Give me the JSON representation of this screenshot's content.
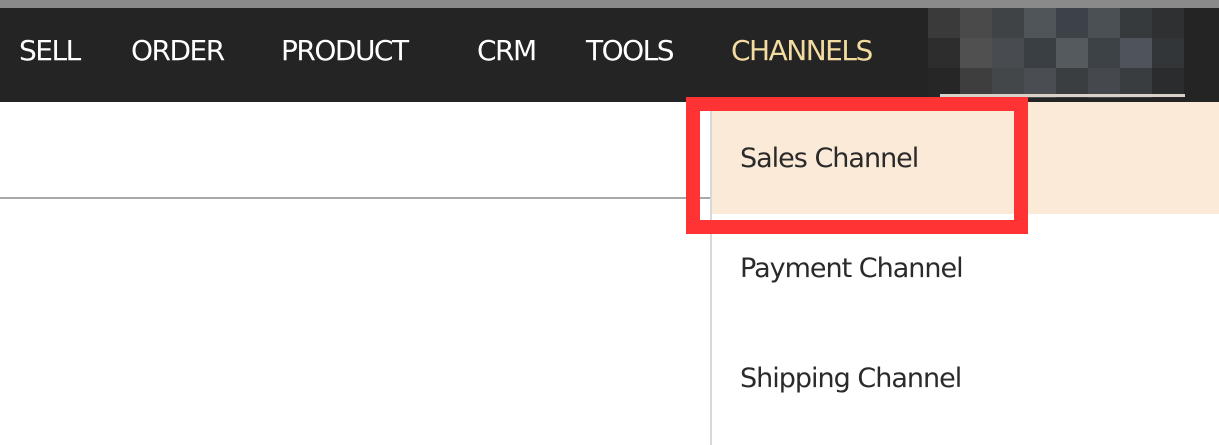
{
  "nav": {
    "items": [
      {
        "label": "SELL"
      },
      {
        "label": "ORDER"
      },
      {
        "label": "PRODUCT"
      },
      {
        "label": "CRM"
      },
      {
        "label": "TOOLS"
      },
      {
        "label": "CHANNELS"
      }
    ],
    "active": "CHANNELS"
  },
  "dropdown": {
    "items": [
      {
        "label": "Sales Channel",
        "highlighted": true
      },
      {
        "label": "Payment Channel"
      },
      {
        "label": "Shipping Channel"
      }
    ]
  },
  "colors": {
    "navbar": "#242424",
    "nav_text": "#ffffff",
    "nav_active": "#f3dca0",
    "highlight_bg": "#faead7",
    "annotation_red": "#ff3333"
  }
}
